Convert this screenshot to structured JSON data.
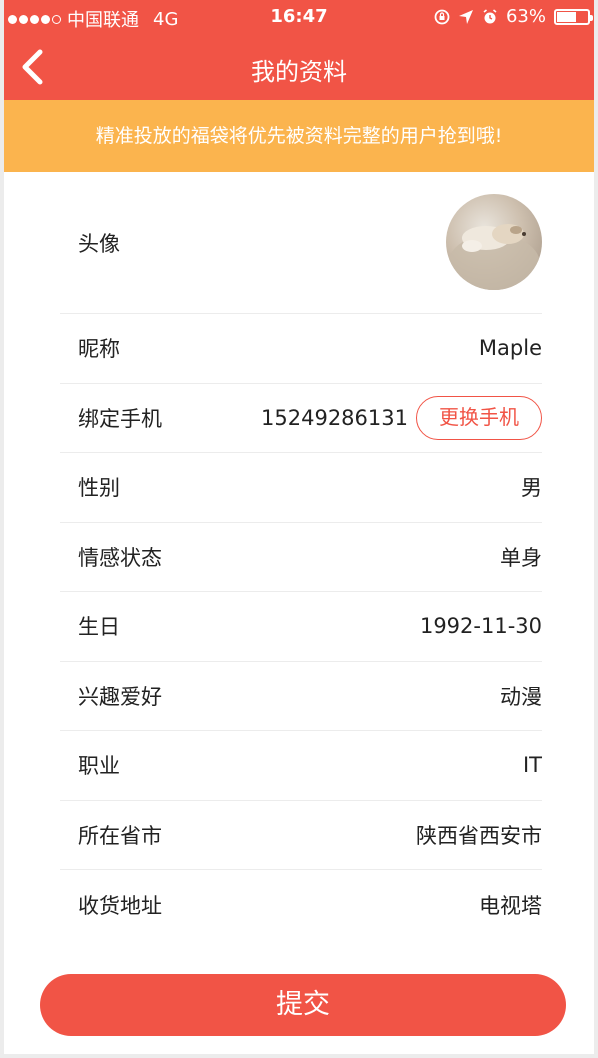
{
  "status_bar": {
    "carrier": "中国联通",
    "network": "4G",
    "time": "16:47",
    "battery": "63%",
    "battery_level": 0.63
  },
  "nav": {
    "title": "我的资料"
  },
  "banner": {
    "text": "精准投放的福袋将优先被资料完整的用户抢到哦!"
  },
  "profile": {
    "avatar_label": "头像",
    "nickname_label": "昵称",
    "nickname": "Maple",
    "phone_label": "绑定手机",
    "phone": "15249286131",
    "change_phone_label": "更换手机",
    "gender_label": "性别",
    "gender": "男",
    "relationship_label": "情感状态",
    "relationship": "单身",
    "birthday_label": "生日",
    "birthday": "1992-11-30",
    "hobby_label": "兴趣爱好",
    "hobby": "动漫",
    "job_label": "职业",
    "job": "IT",
    "city_label": "所在省市",
    "city": "陕西省西安市",
    "address_label": "收货地址",
    "address": "电视塔"
  },
  "submit_label": "提交",
  "colors": {
    "primary": "#f15446",
    "banner": "#fbb44e",
    "divider": "#ececec"
  }
}
